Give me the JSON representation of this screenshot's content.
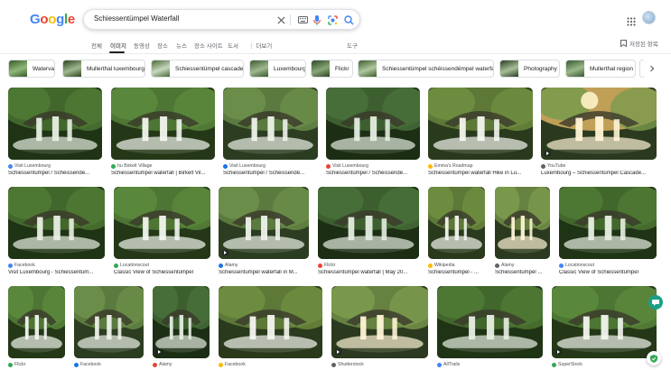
{
  "search": {
    "query": "Schiessentümpel Waterfall"
  },
  "tabs": [
    "전체",
    "이미지",
    "동영상",
    "장소",
    "뉴스",
    "장소 사이트",
    "도서",
    "더보기",
    "도구"
  ],
  "saved_label": "저장된 항목",
  "chips": [
    {
      "label": "Waterval"
    },
    {
      "label": "Mullerthal luxembourg"
    },
    {
      "label": "Schiessentümpel cascade"
    },
    {
      "label": "Luxembourg"
    },
    {
      "label": "Flickr"
    },
    {
      "label": "Schiessentümpel schéissendëmpel waterfall"
    },
    {
      "label": "Photography"
    },
    {
      "label": "Mullerthal region"
    }
  ],
  "results": [
    {
      "source": "Visit Luxembourg",
      "title": "Schiessentümpel / Schéissendë..."
    },
    {
      "source": "hu Birkelt Village",
      "title": "Schiessentümpel waterfall | Birkelt Vil..."
    },
    {
      "source": "Visit Luxembourg",
      "title": "Schiessentümpel / Schéissendë..."
    },
    {
      "source": "Visit Luxembourg",
      "title": "Schiessentümpel / Schéissendë..."
    },
    {
      "source": "Emma's Roadmap",
      "title": "Schiessentümpel waterfall Hike in Lu..."
    },
    {
      "source": "YouTube",
      "title": "Luxembourg – Schiessentümpel Cascade..."
    },
    {
      "source": "Facebook",
      "title": "Visit Luxembourg - Schiessentüm..."
    },
    {
      "source": "Locationscout",
      "title": "Classic View of Schiessentümpel"
    },
    {
      "source": "Alamy",
      "title": "Schiessentümpel waterfall in M..."
    },
    {
      "source": "Flickr",
      "title": "Schiessentümpel waterfall | May 20..."
    },
    {
      "source": "Wikipedia",
      "title": "Schiessentümpel - ..."
    },
    {
      "source": "Alamy",
      "title": "Schiessentümpel ..."
    },
    {
      "source": "Locationscout",
      "title": "Classic View of Schiessentümpel"
    },
    {
      "source": "Flickr",
      "title": ""
    },
    {
      "source": "Facebook",
      "title": ""
    },
    {
      "source": "Alamy",
      "title": ""
    },
    {
      "source": "Facebook",
      "title": ""
    },
    {
      "source": "Shutterstock",
      "title": ""
    },
    {
      "source": "AllTrails",
      "title": ""
    },
    {
      "source": "SuperStock",
      "title": ""
    }
  ],
  "colors": {
    "accent": "#4285f4",
    "chat": "#1a9f86",
    "shield": "#34a853"
  }
}
